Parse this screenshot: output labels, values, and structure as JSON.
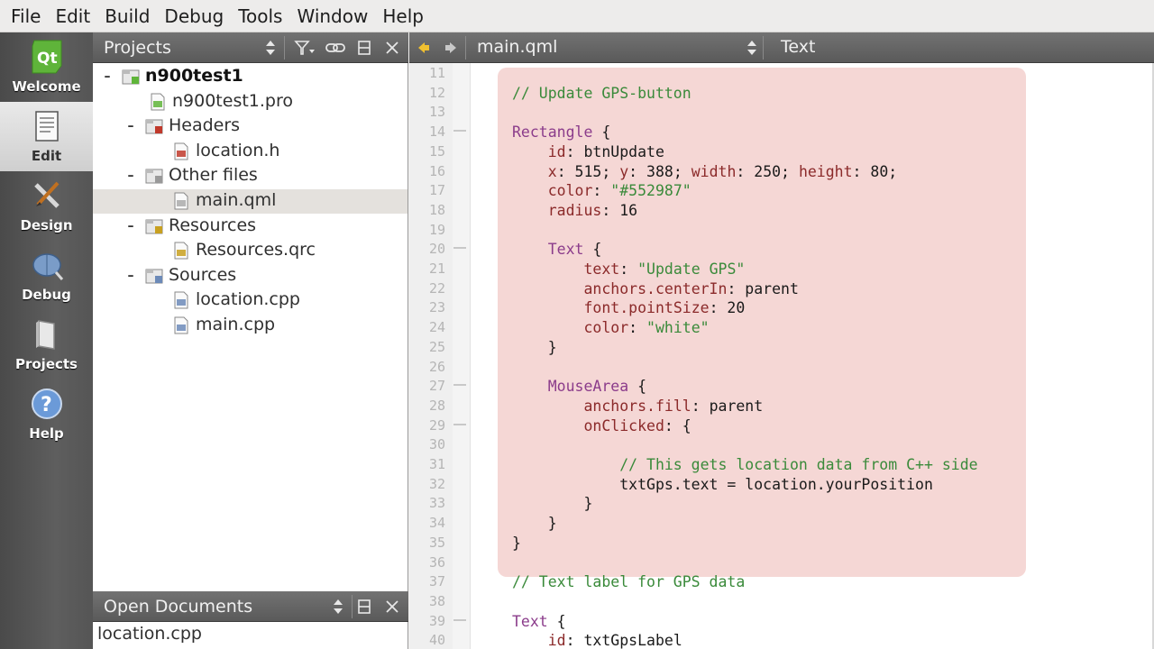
{
  "menu": [
    "File",
    "Edit",
    "Build",
    "Debug",
    "Tools",
    "Window",
    "Help"
  ],
  "modes": [
    {
      "label": "Welcome",
      "icon": "qt-logo-icon"
    },
    {
      "label": "Edit",
      "icon": "document-edit-icon"
    },
    {
      "label": "Design",
      "icon": "design-tools-icon"
    },
    {
      "label": "Debug",
      "icon": "debug-bug-icon"
    },
    {
      "label": "Projects",
      "icon": "projects-folder-icon"
    },
    {
      "label": "Help",
      "icon": "help-question-icon"
    }
  ],
  "projects_panel": {
    "title": "Projects",
    "tree": [
      {
        "label": "n900test1",
        "icon": "qt-project-icon"
      },
      {
        "label": "n900test1.pro",
        "icon": "pro-file-icon"
      },
      {
        "label": "Headers",
        "icon": "header-folder-icon"
      },
      {
        "label": "location.h",
        "icon": "header-file-icon"
      },
      {
        "label": "Other files",
        "icon": "folder-icon"
      },
      {
        "label": "main.qml",
        "icon": "qml-file-icon"
      },
      {
        "label": "Resources",
        "icon": "resource-folder-icon"
      },
      {
        "label": "Resources.qrc",
        "icon": "qrc-file-icon"
      },
      {
        "label": "Sources",
        "icon": "source-folder-icon"
      },
      {
        "label": "location.cpp",
        "icon": "cpp-file-icon"
      },
      {
        "label": "main.cpp",
        "icon": "cpp-file-icon"
      }
    ]
  },
  "open_documents": {
    "title": "Open Documents",
    "items": [
      "location.cpp"
    ]
  },
  "editor_header": {
    "file": "main.qml",
    "symbol": "Text"
  },
  "editor": {
    "line_numbers": [
      "11",
      "12",
      "13",
      "14",
      "15",
      "16",
      "17",
      "18",
      "19",
      "20",
      "21",
      "22",
      "23",
      "24",
      "25",
      "26",
      "27",
      "28",
      "29",
      "30",
      "31",
      "32",
      "33",
      "34",
      "35",
      "36",
      "37",
      "38",
      "39",
      "40"
    ],
    "lines": [
      "",
      "// Update GPS-button",
      "",
      "Rectangle {",
      "    id: btnUpdate",
      "    x: 515; y: 388; width: 250; height: 80;",
      "    color: \"#552987\"",
      "    radius: 16",
      "",
      "    Text {",
      "        text: \"Update GPS\"",
      "        anchors.centerIn: parent",
      "        font.pointSize: 20",
      "        color: \"white\"",
      "    }",
      "",
      "    MouseArea {",
      "        anchors.fill: parent",
      "        onClicked: {",
      "",
      "            // This gets location data from C++ side",
      "            txtGps.text = location.yourPosition",
      "        }",
      "    }",
      "}",
      "",
      "// Text label for GPS data",
      "",
      "Text {",
      "    id: txtGpsLabel"
    ]
  },
  "colors": {
    "highlight": "#f5d7d5",
    "panel_header": "#666666",
    "comment": "#3a8a3a",
    "type": "#8b3c8b",
    "property": "#8b2a2a"
  }
}
